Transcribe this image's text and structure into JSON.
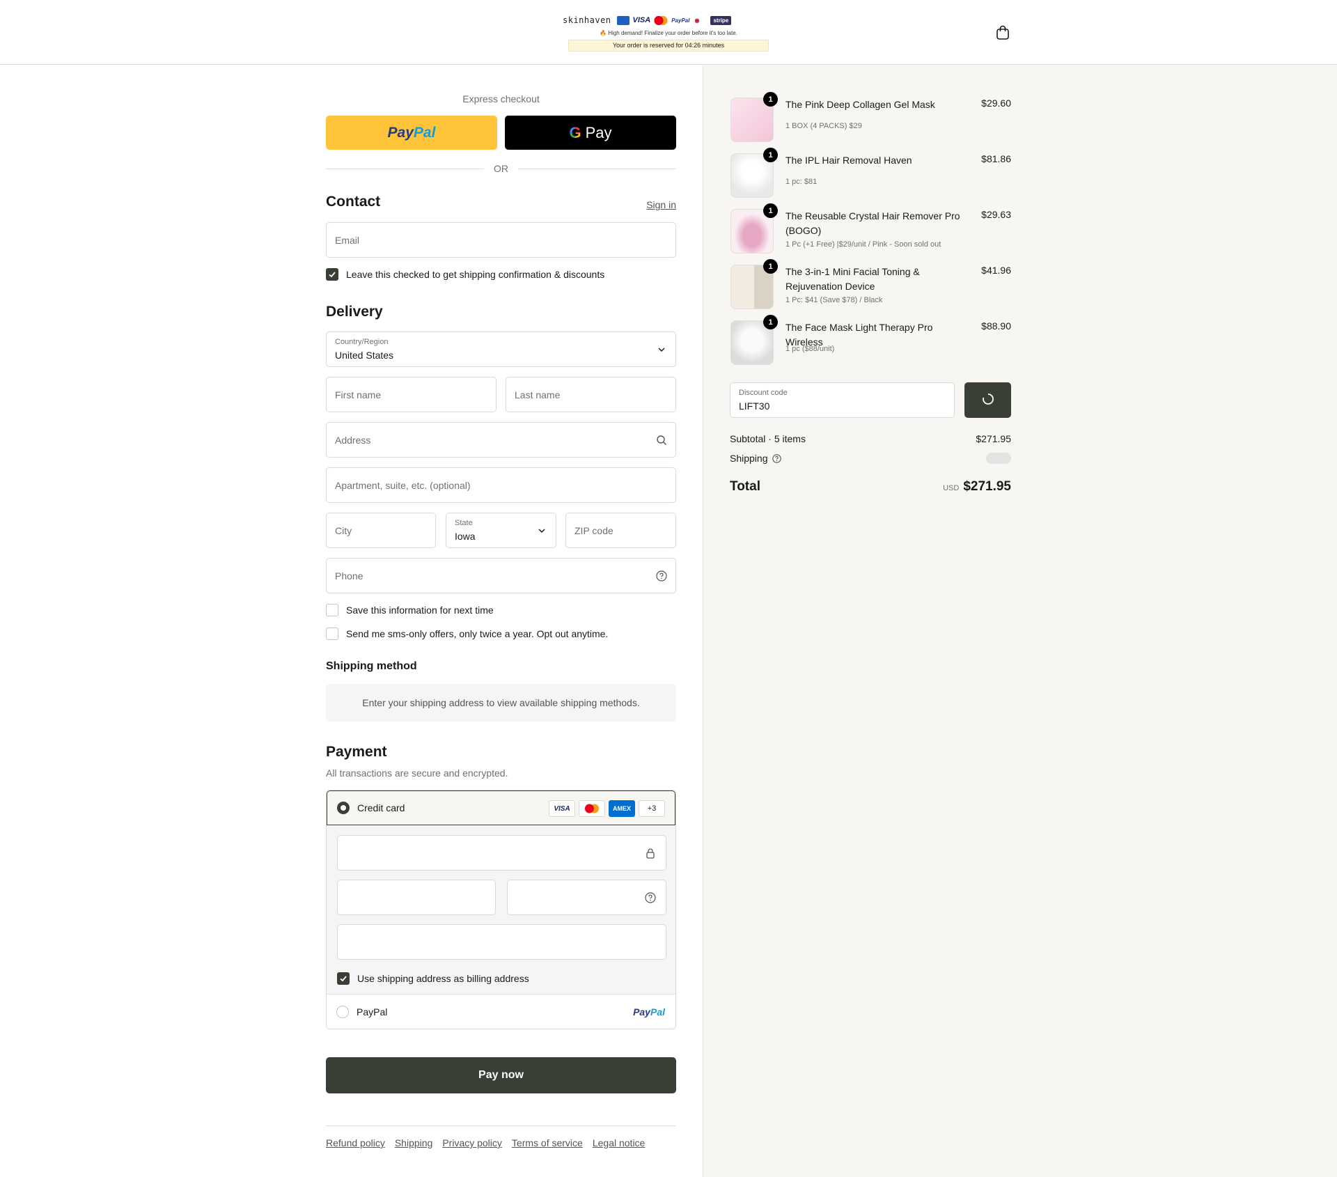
{
  "header": {
    "brand": "skinhaven",
    "trust_badges": [
      "VISA",
      "PayPal",
      "stripe"
    ],
    "high_demand": "🔥 High demand! Finalize your order before it's too late.",
    "reserve_prefix": "Your order is reserved for ",
    "reserve_time": "04:26",
    "reserve_suffix": " minutes",
    "cart_icon": "bag-icon"
  },
  "express": {
    "label": "Express checkout",
    "paypal_a": "Pay",
    "paypal_b": "Pal",
    "gpay_label": "Pay",
    "or": "OR"
  },
  "contact": {
    "title": "Contact",
    "sign_in": "Sign in",
    "email_placeholder": "Email",
    "marketing_label": "Leave this checked to get shipping confirmation & discounts",
    "marketing_checked": true
  },
  "delivery": {
    "title": "Delivery",
    "country_label": "Country/Region",
    "country_value": "United States",
    "first_name": "First name",
    "last_name": "Last name",
    "address": "Address",
    "apartment": "Apartment, suite, etc. (optional)",
    "city": "City",
    "state_label": "State",
    "state_value": "Iowa",
    "zip": "ZIP code",
    "phone": "Phone",
    "save_info": "Save this information for next time",
    "sms_offers": "Send me sms-only offers, only twice a year. Opt out anytime."
  },
  "shipping_method": {
    "title": "Shipping method",
    "notice": "Enter your shipping address to view available shipping methods."
  },
  "payment": {
    "title": "Payment",
    "subtitle": "All transactions are secure and encrypted.",
    "credit_card_label": "Credit card",
    "card_brands": [
      "VISA",
      "Mastercard",
      "AMEX",
      "+3"
    ],
    "billing_same_label": "Use shipping address as billing address",
    "billing_same_checked": true,
    "paypal_label": "PayPal",
    "paypal_logo_a": "Pay",
    "paypal_logo_b": "Pal"
  },
  "pay_now": "Pay now",
  "footer_links": [
    "Refund policy",
    "Shipping",
    "Privacy policy",
    "Terms of service",
    "Legal notice"
  ],
  "summary": {
    "items": [
      {
        "name": "The Pink Deep Collagen Gel Mask",
        "variant": "1 BOX (4 PACKS) $29",
        "price": "$29.60",
        "qty": "1"
      },
      {
        "name": "The IPL Hair Removal Haven",
        "variant": "1 pc: $81",
        "price": "$81.86",
        "qty": "1"
      },
      {
        "name": "The Reusable Crystal Hair Remover Pro (BOGO)",
        "variant": "1 Pc (+1 Free) |$29/unit / Pink - Soon sold out",
        "price": "$29.63",
        "qty": "1"
      },
      {
        "name": "The 3-in-1 Mini Facial Toning & Rejuvenation Device",
        "variant": "1 Pc: $41 (Save $78) / Black",
        "price": "$41.96",
        "qty": "1"
      },
      {
        "name": "The Face Mask Light Therapy Pro Wireless",
        "variant": "1 pc ($88/unit)",
        "price": "$88.90",
        "qty": "1"
      }
    ],
    "discount_label": "Discount code",
    "discount_value": "LIFT30",
    "subtotal_label": "Subtotal · 5 items",
    "subtotal_value": "$271.95",
    "shipping_label": "Shipping",
    "total_label": "Total",
    "currency": "USD",
    "total_value": "$271.95"
  }
}
